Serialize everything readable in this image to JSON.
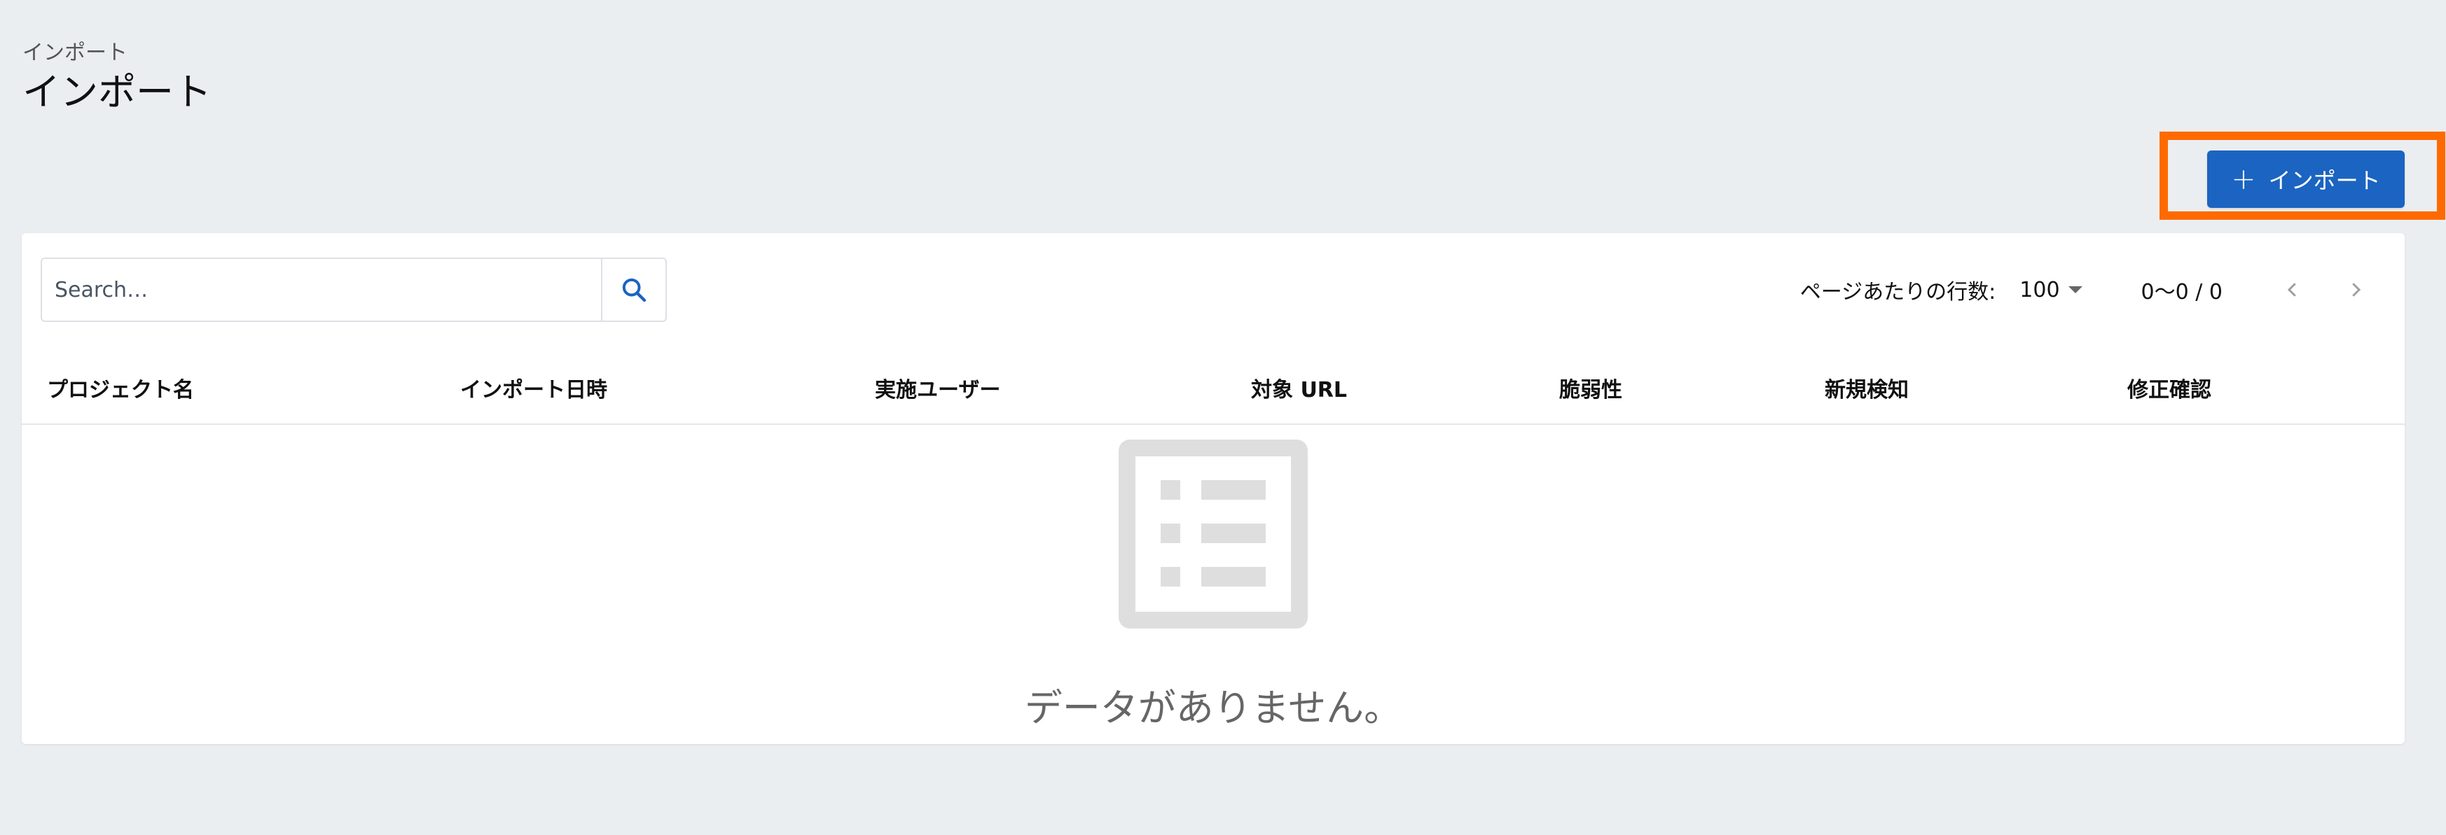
{
  "breadcrumb": "インポート",
  "page_title": "インポート",
  "import_button": {
    "label": "インポート"
  },
  "search": {
    "placeholder": "Search…",
    "value": ""
  },
  "pagination": {
    "rows_per_page_label": "ページあたりの行数:",
    "rows_per_page_value": "100",
    "range_text": "0〜0 / 0"
  },
  "columns": [
    "プロジェクト名",
    "インポート日時",
    "実施ユーザー",
    "対象 URL",
    "脆弱性",
    "新規検知",
    "修正確認"
  ],
  "empty_message": "データがありません。",
  "colors": {
    "accent": "#1b64c1",
    "highlight": "#ff6a00",
    "background": "#ebeef1"
  },
  "icons": {
    "add": "plus-icon",
    "search": "search-icon",
    "prev": "chevron-left-icon",
    "next": "chevron-right-icon",
    "empty": "list-icon"
  }
}
